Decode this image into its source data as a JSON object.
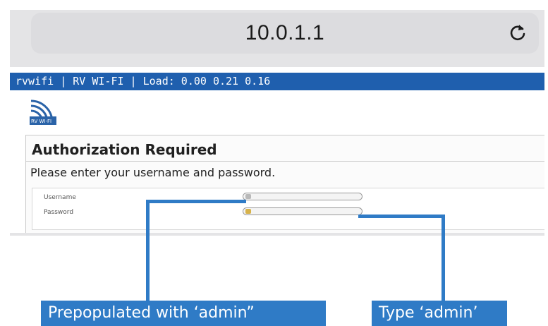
{
  "browser": {
    "address": "10.0.1.1",
    "reload_icon": "reload-icon"
  },
  "router_page": {
    "status_bar": "rvwifi | RV WI-FI | Load: 0.00 0.21 0.16",
    "logo_text": "RV WI-FI",
    "panel_title": "Authorization Required",
    "panel_message": "Please enter your username and password.",
    "username_label": "Username",
    "password_label": "Password"
  },
  "callouts": {
    "username_note": "Prepopulated with ‘admin”",
    "password_note": "Type ‘admin’"
  },
  "colors": {
    "status_bar": "#1f5fae",
    "callout": "#2f7bc6"
  }
}
